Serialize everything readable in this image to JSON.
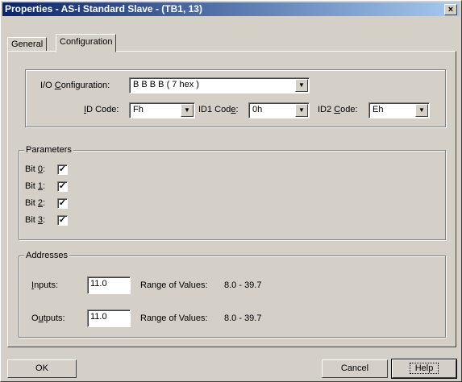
{
  "window": {
    "title": "Properties - AS-i Standard Slave - (TB1, 13)",
    "close_glyph": "×"
  },
  "tabs": [
    {
      "label": "General"
    },
    {
      "label": "Configuration"
    }
  ],
  "io_group": {
    "io_configuration": {
      "label_pre": "I/O ",
      "label_u": "C",
      "label_post": "onfiguration:",
      "value": "B B B B ( 7 hex )"
    },
    "id_code": {
      "label_pre": "",
      "label_u": "I",
      "label_post": "D Code:",
      "value": "Fh"
    },
    "id1_code": {
      "label_pre": "ID1 Cod",
      "label_u": "e",
      "label_post": ":",
      "value": "0h"
    },
    "id2_code": {
      "label_pre": "ID2 ",
      "label_u": "C",
      "label_post": "ode:",
      "value": "Eh"
    }
  },
  "parameters": {
    "legend": "Parameters",
    "bits": [
      {
        "label_pre": "Bit ",
        "label_u": "0",
        "label_post": ":",
        "checked": "✓"
      },
      {
        "label_pre": "Bit ",
        "label_u": "1",
        "label_post": ":",
        "checked": "✓"
      },
      {
        "label_pre": "Bit ",
        "label_u": "2",
        "label_post": ":",
        "checked": "✓"
      },
      {
        "label_pre": "Bit ",
        "label_u": "3",
        "label_post": ":",
        "checked": "✓"
      }
    ]
  },
  "addresses": {
    "legend": "Addresses",
    "inputs": {
      "label_u": "I",
      "label_post": "nputs:",
      "value": "11.0",
      "range_label": "Range of Values:",
      "range": "8.0 - 39.7"
    },
    "outputs": {
      "label_pre": "O",
      "label_u": "u",
      "label_post": "tputs:",
      "value": "11.0",
      "range_label": "Range of Values:",
      "range": "8.0 - 39.7"
    }
  },
  "buttons": {
    "ok": "OK",
    "cancel": "Cancel",
    "help": "Help"
  },
  "icons": {
    "dropdown": "▼"
  }
}
